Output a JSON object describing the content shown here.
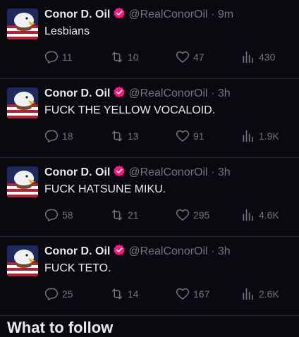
{
  "posts": [
    {
      "name": "Conor D. Oil",
      "handle": "@RealConorOil",
      "sep": "·",
      "time": "9m",
      "text": "Lesbians",
      "replies": "11",
      "reposts": "10",
      "likes": "47",
      "views": "430"
    },
    {
      "name": "Conor D. Oil",
      "handle": "@RealConorOil",
      "sep": "·",
      "time": "3h",
      "text": "FUCK THE YELLOW VOCALOID.",
      "replies": "18",
      "reposts": "13",
      "likes": "91",
      "views": "1.9K"
    },
    {
      "name": "Conor D. Oil",
      "handle": "@RealConorOil",
      "sep": "·",
      "time": "3h",
      "text": "FUCK HATSUNE MIKU.",
      "replies": "58",
      "reposts": "21",
      "likes": "295",
      "views": "4.6K"
    },
    {
      "name": "Conor D. Oil",
      "handle": "@RealConorOil",
      "sep": "·",
      "time": "3h",
      "text": "FUCK TETO.",
      "replies": "25",
      "reposts": "14",
      "likes": "167",
      "views": "2.6K"
    }
  ],
  "section": {
    "title": "What to follow"
  },
  "icons": {
    "avatar": "eagle-flag-avatar",
    "badge": "verified-badge-icon",
    "reply": "reply-icon",
    "repost": "repost-icon",
    "like": "heart-icon",
    "views": "views-icon"
  },
  "colors": {
    "background": "#0a0910",
    "badge": "#f91880",
    "muted": "#71767b"
  }
}
